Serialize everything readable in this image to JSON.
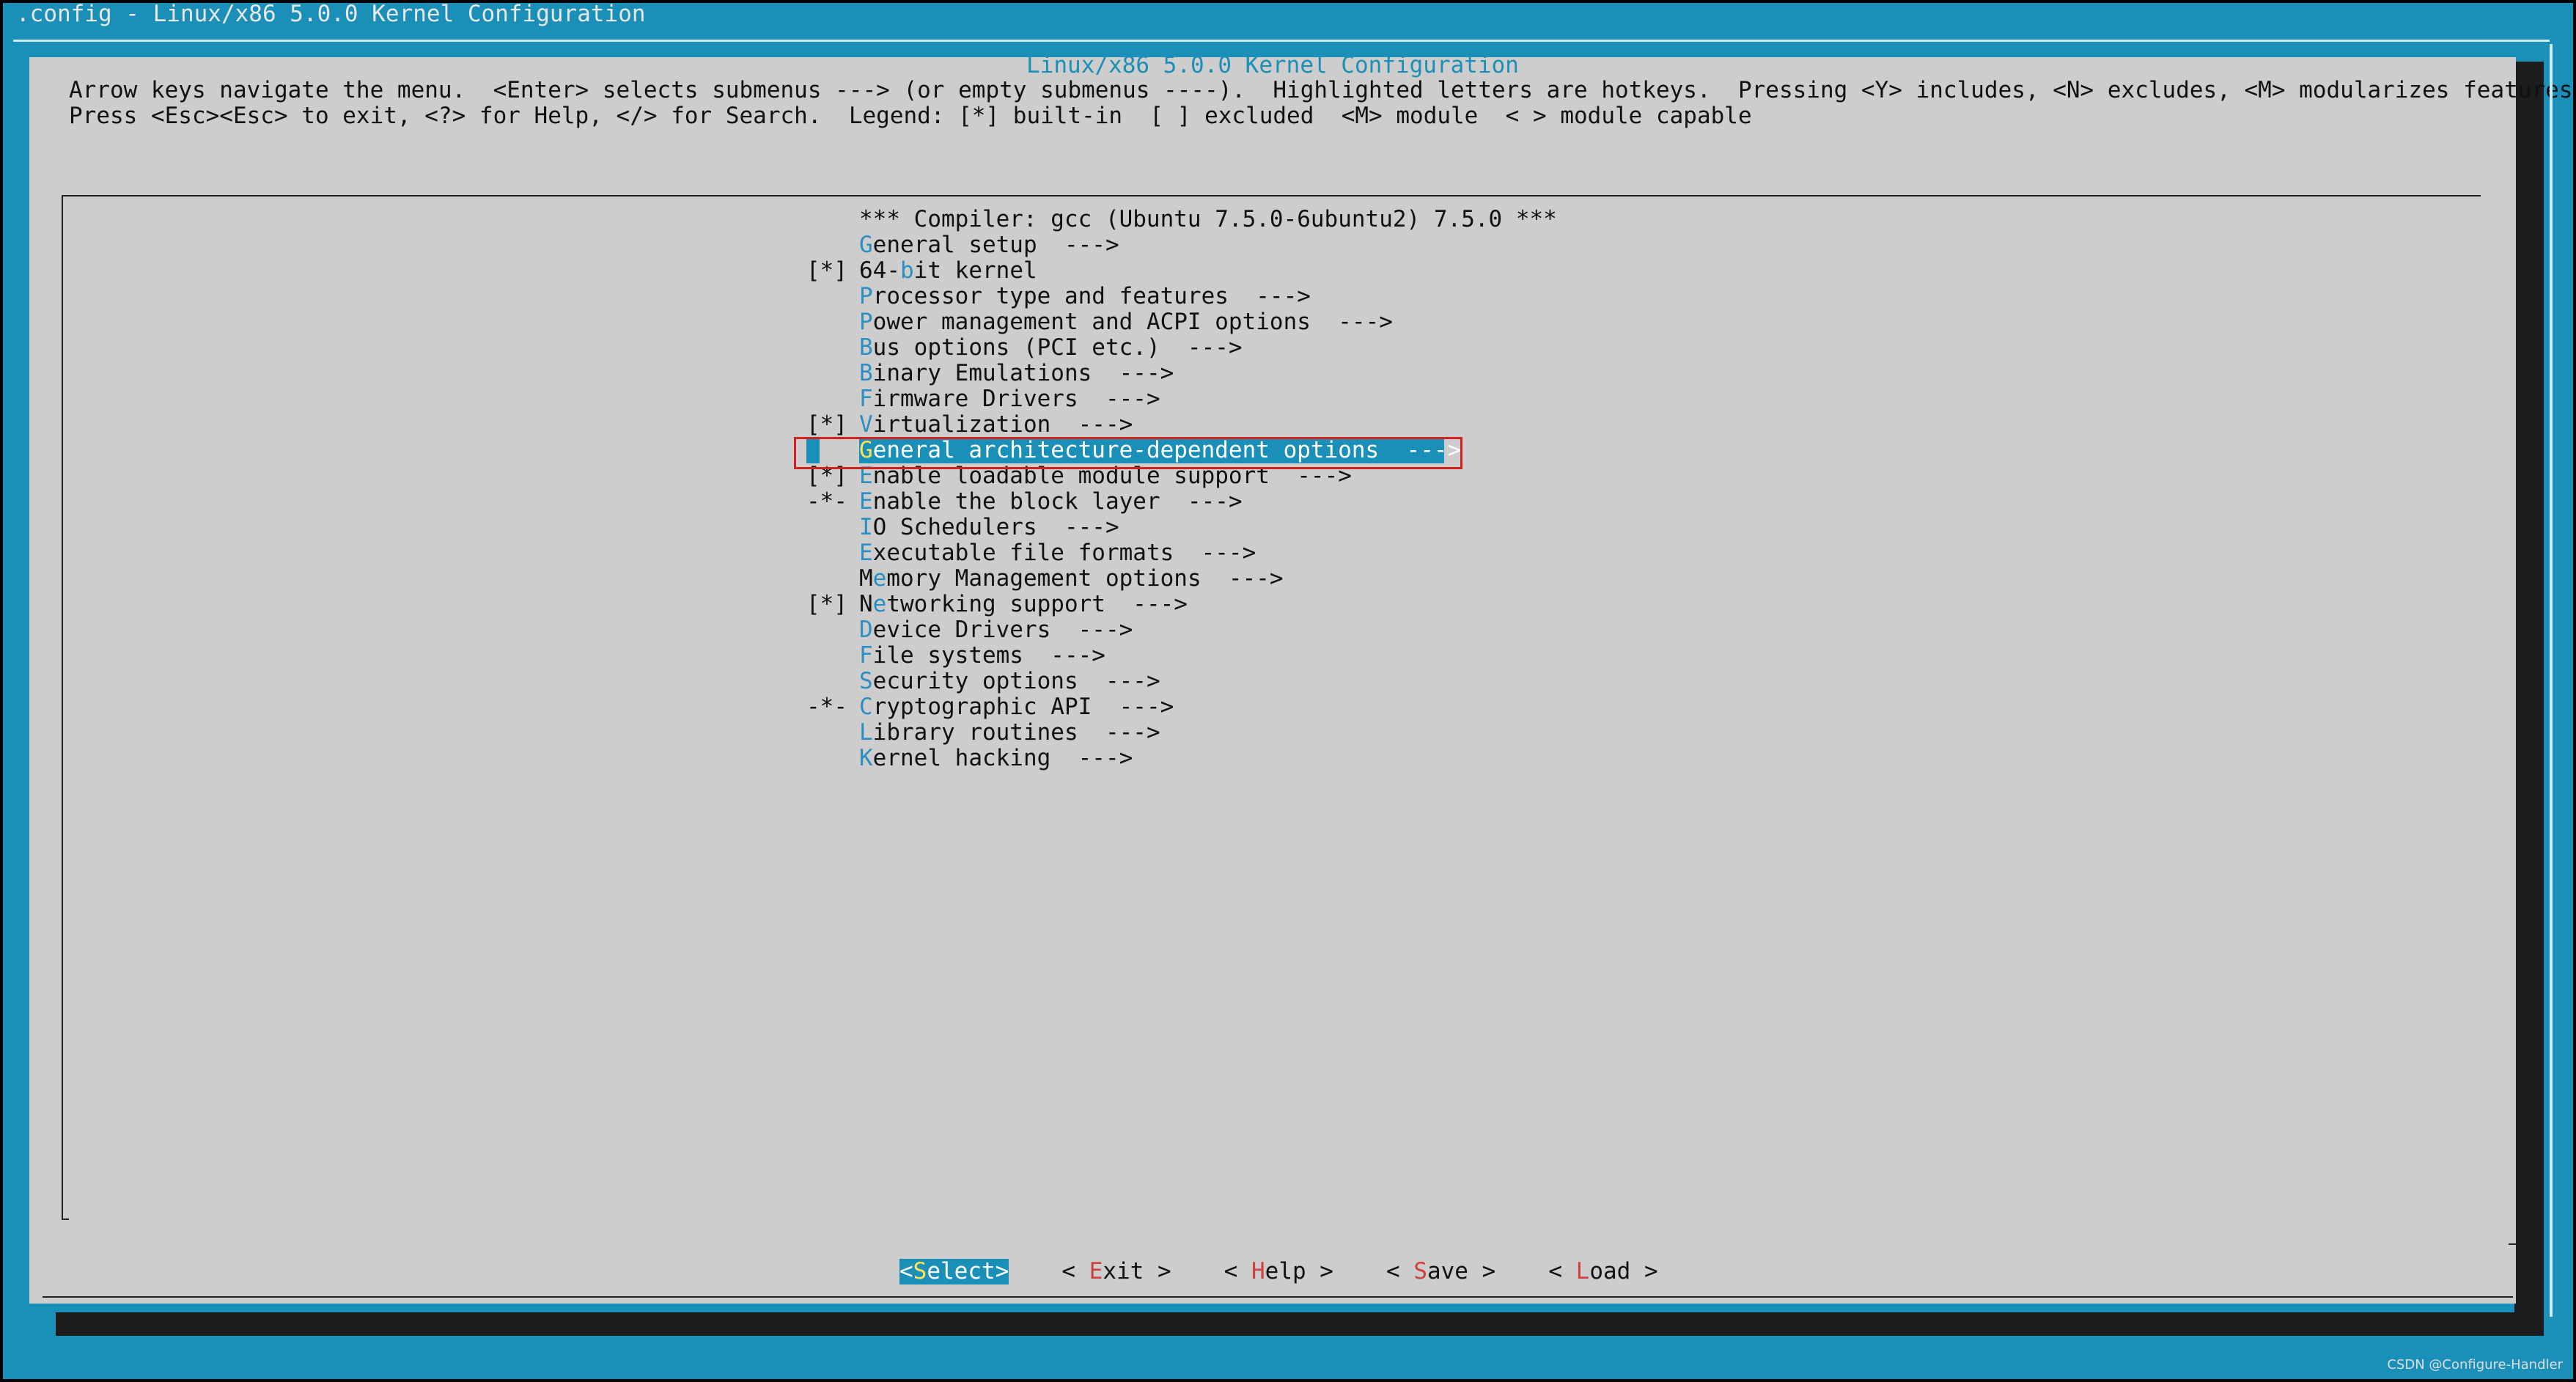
{
  "window": {
    "title": ".config - Linux/x86 5.0.0 Kernel Configuration"
  },
  "dialog": {
    "title": "Linux/x86 5.0.0 Kernel Configuration",
    "help_line1": "Arrow keys navigate the menu.  <Enter> selects submenus ---> (or empty submenus ----).  Highlighted letters are hotkeys.  Pressing <Y> includes, <N> excludes, <M> modularizes features.",
    "help_line2": "Press <Esc><Esc> to exit, <?> for Help, </> for Search.  Legend: [*] built-in  [ ] excluded  <M> module  < > module capable"
  },
  "menu": {
    "items": [
      {
        "prefix": "",
        "pre": "",
        "hotkey": "",
        "post": "*** Compiler: gcc (Ubuntu 7.5.0-6ubuntu2) 7.5.0 ***"
      },
      {
        "prefix": "",
        "pre": "",
        "hotkey": "G",
        "post": "eneral setup  --->"
      },
      {
        "prefix": "[*]",
        "pre": "64-",
        "hotkey": "b",
        "post": "it kernel"
      },
      {
        "prefix": "",
        "pre": "",
        "hotkey": "P",
        "post": "rocessor type and features  --->"
      },
      {
        "prefix": "",
        "pre": "",
        "hotkey": "P",
        "post": "ower management and ACPI options  --->"
      },
      {
        "prefix": "",
        "pre": "",
        "hotkey": "B",
        "post": "us options (PCI etc.)  --->"
      },
      {
        "prefix": "",
        "pre": "",
        "hotkey": "B",
        "post": "inary Emulations  --->"
      },
      {
        "prefix": "",
        "pre": "",
        "hotkey": "F",
        "post": "irmware Drivers  --->"
      },
      {
        "prefix": "[*]",
        "pre": "",
        "hotkey": "V",
        "post": "irtualization  --->"
      },
      {
        "prefix": "",
        "pre": "",
        "hotkey": "G",
        "post": "eneral architecture-dependent options  --->"
      },
      {
        "prefix": "[*]",
        "pre": "",
        "hotkey": "E",
        "post": "nable loadable module support  --->"
      },
      {
        "prefix": "-*-",
        "pre": "",
        "hotkey": "E",
        "post": "nable the block layer  --->"
      },
      {
        "prefix": "",
        "pre": "",
        "hotkey": "I",
        "post": "O Schedulers  --->"
      },
      {
        "prefix": "",
        "pre": "",
        "hotkey": "E",
        "post": "xecutable file formats  --->"
      },
      {
        "prefix": "",
        "pre": "M",
        "hotkey": "e",
        "post": "mory Management options  --->"
      },
      {
        "prefix": "[*]",
        "pre": "N",
        "hotkey": "e",
        "post": "tworking support  --->"
      },
      {
        "prefix": "",
        "pre": "",
        "hotkey": "D",
        "post": "evice Drivers  --->"
      },
      {
        "prefix": "",
        "pre": "",
        "hotkey": "F",
        "post": "ile systems  --->"
      },
      {
        "prefix": "",
        "pre": "",
        "hotkey": "S",
        "post": "ecurity options  --->"
      },
      {
        "prefix": "-*-",
        "pre": "",
        "hotkey": "C",
        "post": "ryptographic API  --->"
      },
      {
        "prefix": "",
        "pre": "",
        "hotkey": "L",
        "post": "ibrary routines  --->"
      },
      {
        "prefix": "",
        "pre": "",
        "hotkey": "K",
        "post": "ernel hacking  --->"
      }
    ]
  },
  "buttons": {
    "select": {
      "l": "<",
      "hk": "S",
      "r": "elect>"
    },
    "exit": {
      "l": "< ",
      "hk": "E",
      "r": "xit >"
    },
    "help": {
      "l": "< ",
      "hk": "H",
      "r": "elp >"
    },
    "save": {
      "l": "< ",
      "hk": "S",
      "r": "ave >"
    },
    "load": {
      "l": "< ",
      "hk": "L",
      "r": "oad >"
    }
  },
  "watermark": "CSDN @Configure-Handler",
  "colors": {
    "background": "#1a8fb8",
    "dialog": "#cdcdcd",
    "highlight": "#1a8fb8",
    "hotkey": "#2b8fc4",
    "button_hotkey": "#d04040",
    "annotation_box": "#d02020"
  }
}
